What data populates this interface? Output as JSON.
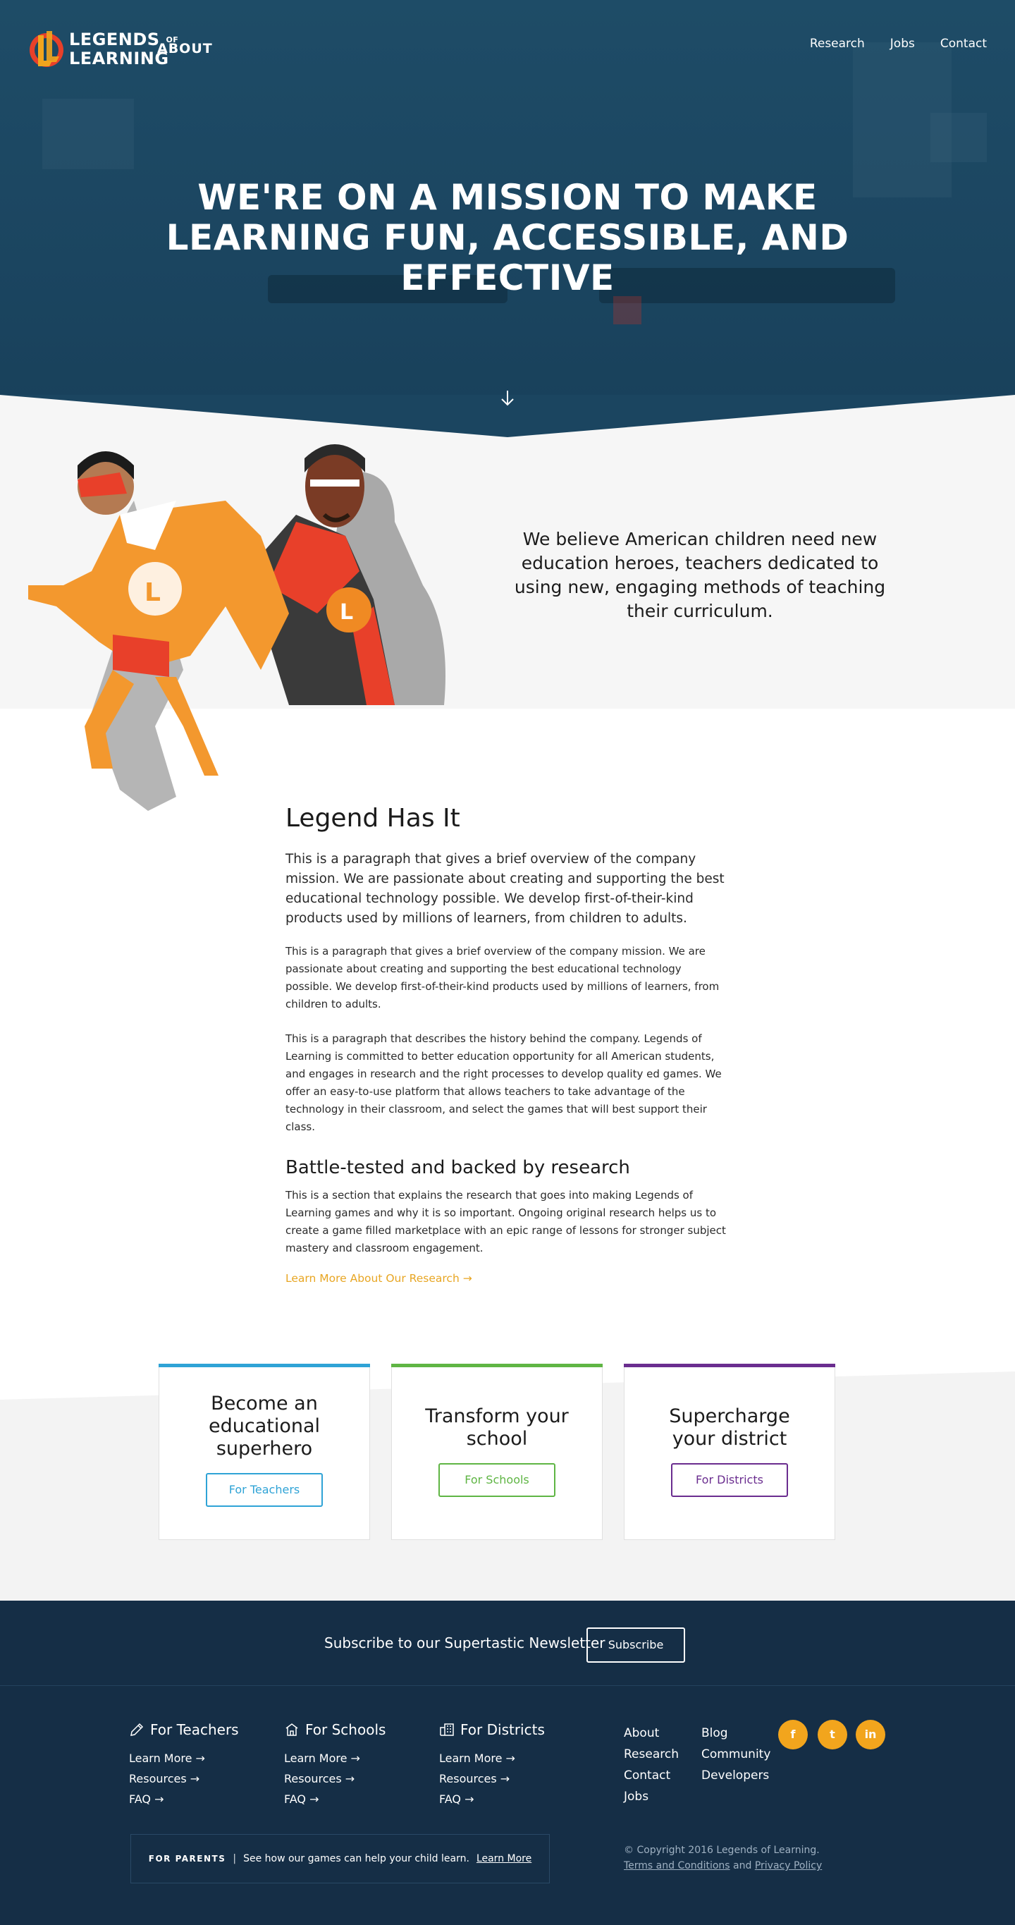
{
  "brand": {
    "logo_line1": "LEGENDS",
    "logo_of": "OF",
    "logo_line2": "LEARNING",
    "section": "ABOUT"
  },
  "nav": [
    "Research",
    "Jobs",
    "Contact"
  ],
  "hero": {
    "title": "WE'RE ON A MISSION TO MAKE LEARNING FUN, ACCESSIBLE, AND EFFECTIVE"
  },
  "believe": {
    "text": "We believe American children need new education heroes, teachers dedicated to using new, engaging methods of teaching their curriculum."
  },
  "legend": {
    "title": "Legend Has It",
    "lead": "This is a paragraph that gives a brief overview of the company mission. We are passionate about creating and supporting the best educational technology possible. We develop first-of-their-kind products used by millions of learners, from children to adults.",
    "p1": "This is a paragraph that gives a brief overview of the company mission. We are passionate about creating and supporting the best educational technology possible. We develop first-of-their-kind products used by millions of learners, from children to adults.",
    "p2": "This is a paragraph that describes the history behind the company. Legends of Learning is committed to better education opportunity for all American students, and engages in research and the right processes to develop quality ed games. We offer an easy-to-use platform that allows teachers to take advantage of the technology in their classroom, and select the games that will best support their class.",
    "subtitle": "Battle-tested and backed by research",
    "p3": "This is a section that explains the research that goes into making Legends of Learning games and why it is so important. Ongoing original research helps us to create a game filled marketplace with an epic range of lessons for stronger subject mastery and classroom engagement.",
    "link": "Learn More About Our Research →"
  },
  "cards": [
    {
      "title": "Become an educational superhero",
      "button": "For Teachers",
      "color": "#2fa3d6"
    },
    {
      "title": "Transform your school",
      "button": "For Schools",
      "color": "#5fb544"
    },
    {
      "title": "Supercharge your district",
      "button": "For Districts",
      "color": "#6a2d8f"
    }
  ],
  "newsletter": {
    "label": "Subscribe to our Supertastic Newsletter",
    "button": "Subscribe"
  },
  "footer": {
    "teachers": {
      "head": "For Teachers",
      "links": [
        "Learn More →",
        "Resources →",
        "FAQ →"
      ]
    },
    "schools": {
      "head": "For Schools",
      "links": [
        "Learn More →",
        "Resources →",
        "FAQ →"
      ]
    },
    "districts": {
      "head": "For Districts",
      "links": [
        "Learn More →",
        "Resources →",
        "FAQ →"
      ]
    },
    "col1": [
      "About",
      "Research",
      "Contact",
      "Jobs"
    ],
    "col2": [
      "Blog",
      "Community",
      "Developers"
    ],
    "social": [
      "f",
      "t",
      "in"
    ],
    "parents_tag": "FOR PARENTS",
    "parents_sep": "|",
    "parents_text": "See how our games can help your child learn.",
    "parents_link": "Learn More",
    "copyright": "© Copyright 2016 Legends of Learning.",
    "terms": "Terms and Conditions",
    "and": "and",
    "privacy": "Privacy Policy"
  },
  "colors": {
    "hero": "#1c4863",
    "accent": "#f2a51d",
    "footer": "#152e46"
  }
}
